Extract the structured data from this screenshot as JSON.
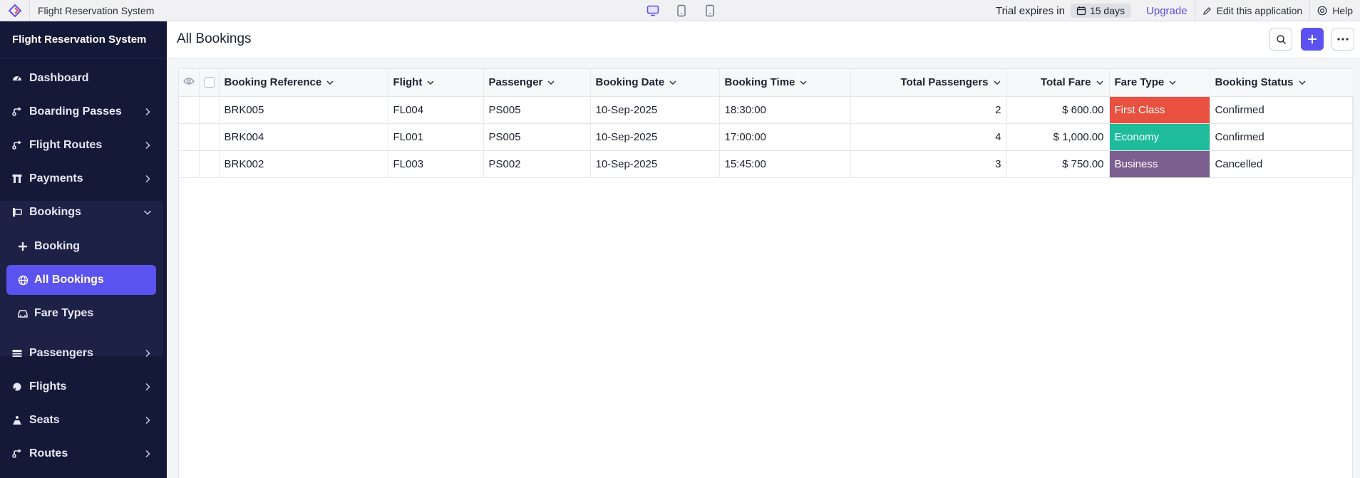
{
  "topbar": {
    "app_name": "Flight Reservation System",
    "trial_text": "Trial expires in",
    "trial_days": "15 days",
    "upgrade_label": "Upgrade",
    "edit_label": "Edit this application",
    "help_label": "Help"
  },
  "sidebar": {
    "title": "Flight Reservation System",
    "items": [
      {
        "label": "Dashboard",
        "icon": "dashboard-icon"
      },
      {
        "label": "Boarding Passes",
        "icon": "boarding-pass-icon"
      },
      {
        "label": "Flight Routes",
        "icon": "route-icon"
      },
      {
        "label": "Payments",
        "icon": "payments-icon"
      },
      {
        "label": "Bookings",
        "icon": "bookings-icon"
      },
      {
        "label": "Passengers",
        "icon": "passengers-icon"
      },
      {
        "label": "Flights",
        "icon": "flights-icon"
      },
      {
        "label": "Seats",
        "icon": "seats-icon"
      },
      {
        "label": "Routes",
        "icon": "routes-icon"
      }
    ],
    "bookings_sub": [
      {
        "label": "Booking",
        "icon": "plus-icon"
      },
      {
        "label": "All Bookings",
        "icon": "globe-icon",
        "active": true
      },
      {
        "label": "Fare Types",
        "icon": "car-icon"
      }
    ]
  },
  "header": {
    "title": "All Bookings"
  },
  "table": {
    "columns": [
      "Booking Reference",
      "Flight",
      "Passenger",
      "Booking Date",
      "Booking Time",
      "Total Passengers",
      "Total Fare",
      "Fare Type",
      "Booking Status"
    ],
    "rows": [
      {
        "ref": "BRK005",
        "flight": "FL004",
        "passenger": "PS005",
        "date": "10-Sep-2025",
        "time": "18:30:00",
        "pax": "2",
        "fare": "$ 600.00",
        "fare_type": "First Class",
        "fare_color": "#e8503f",
        "status": "Confirmed"
      },
      {
        "ref": "BRK004",
        "flight": "FL001",
        "passenger": "PS005",
        "date": "10-Sep-2025",
        "time": "17:00:00",
        "pax": "4",
        "fare": "$ 1,000.00",
        "fare_type": "Economy",
        "fare_color": "#1fbc9c",
        "status": "Confirmed"
      },
      {
        "ref": "BRK002",
        "flight": "FL003",
        "passenger": "PS002",
        "date": "10-Sep-2025",
        "time": "15:45:00",
        "pax": "3",
        "fare": "$ 750.00",
        "fare_type": "Business",
        "fare_color": "#7b5f8f",
        "status": "Cancelled"
      }
    ]
  },
  "colors": {
    "accent": "#5b52f0",
    "sidebar_bg": "#151938"
  }
}
